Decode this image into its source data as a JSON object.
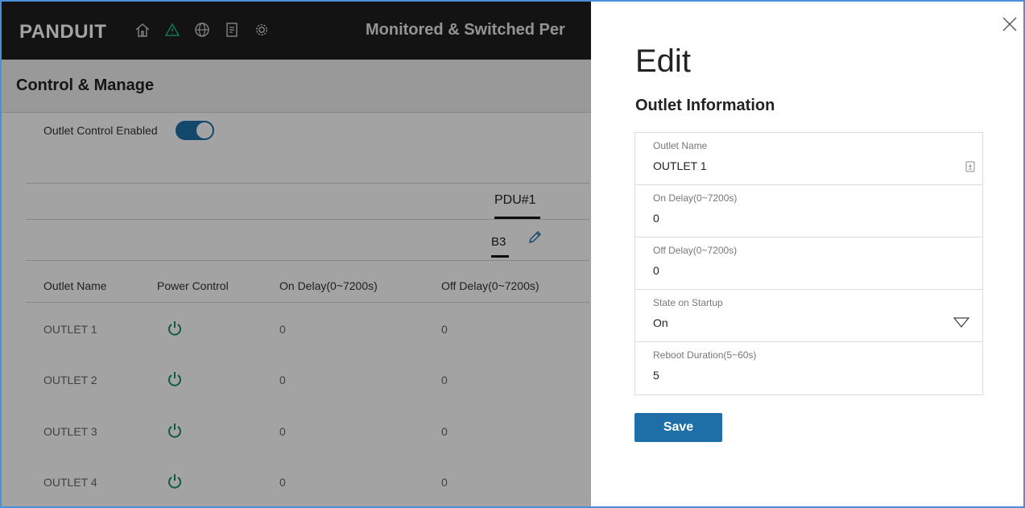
{
  "app": {
    "logo": "PANDUIT",
    "title": "Monitored & Switched Per",
    "nav_icons": [
      "home-icon",
      "warning-icon",
      "globe-icon",
      "document-icon",
      "gear-icon"
    ]
  },
  "page": {
    "title": "Control & Manage",
    "toggle_label": "Outlet Control Enabled"
  },
  "tabs": {
    "pdu": "PDU#1",
    "bank": "B3"
  },
  "table": {
    "headers": [
      "Outlet Name",
      "Power Control",
      "On Delay(0~7200s)",
      "Off Delay(0~7200s)"
    ],
    "rows": [
      {
        "name": "OUTLET 1",
        "on_delay": "0",
        "off_delay": "0"
      },
      {
        "name": "OUTLET 2",
        "on_delay": "0",
        "off_delay": "0"
      },
      {
        "name": "OUTLET 3",
        "on_delay": "0",
        "off_delay": "0"
      },
      {
        "name": "OUTLET 4",
        "on_delay": "0",
        "off_delay": "0"
      }
    ]
  },
  "edit_panel": {
    "title": "Edit",
    "section_title": "Outlet Information",
    "fields": [
      {
        "label": "Outlet Name",
        "value": "OUTLET 1"
      },
      {
        "label": "On Delay(0~7200s)",
        "value": "0"
      },
      {
        "label": "Off Delay(0~7200s)",
        "value": "0"
      },
      {
        "label": "State on Startup",
        "value": "On"
      },
      {
        "label": "Reboot Duration(5~60s)",
        "value": "5"
      }
    ],
    "save_label": "Save"
  },
  "colors": {
    "accent": "#1e6fa8",
    "power_green": "#1a8f5a",
    "warning_green": "#1fb67a"
  }
}
